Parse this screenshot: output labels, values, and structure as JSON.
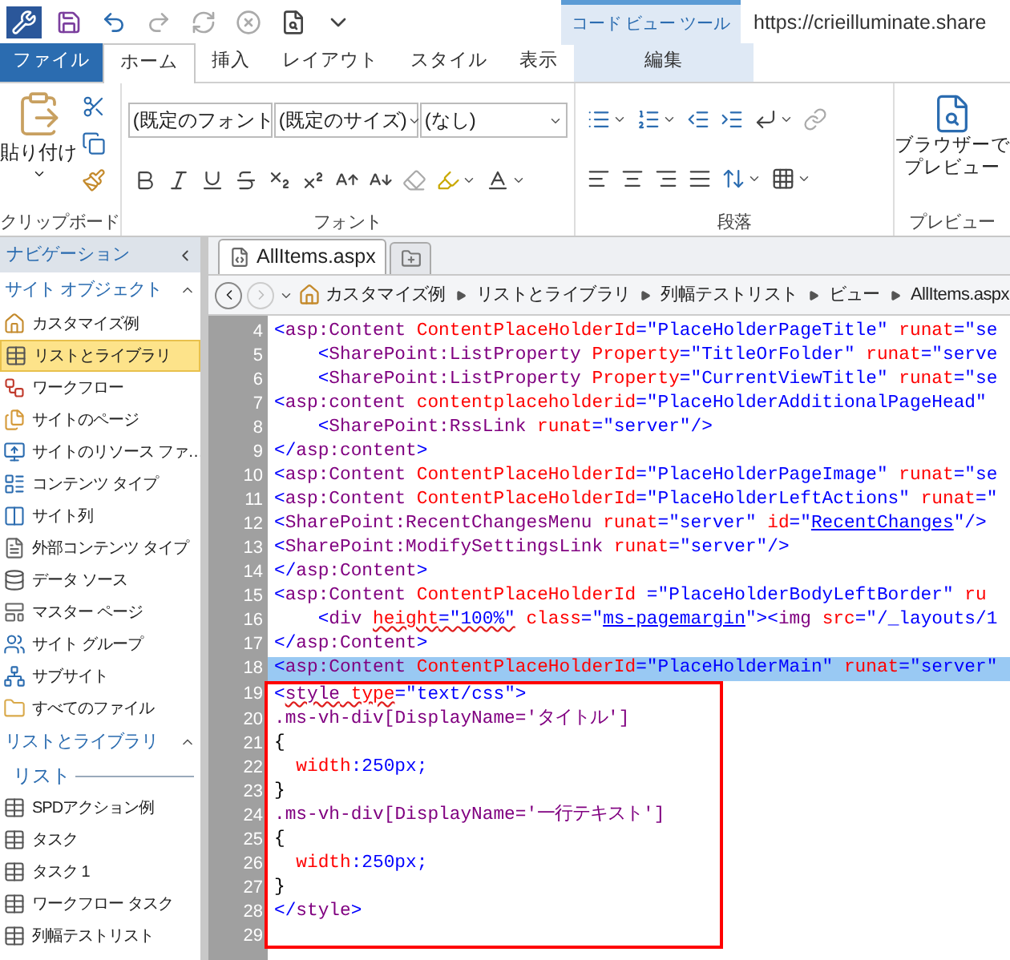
{
  "quick_access": [
    {
      "kind": "app",
      "disabled": false
    },
    {
      "kind": "save",
      "disabled": false
    },
    {
      "kind": "undo",
      "disabled": false
    },
    {
      "kind": "redo",
      "disabled": true
    },
    {
      "kind": "refresh",
      "disabled": true
    },
    {
      "kind": "stop",
      "disabled": true
    },
    {
      "kind": "preview",
      "disabled": false
    },
    {
      "kind": "customize",
      "disabled": false
    }
  ],
  "context_group": "コード ビュー ツール",
  "url": "https://crieilluminate.share",
  "ribbon_tabs": [
    {
      "label": "ファイル",
      "kind": "file",
      "selected": false
    },
    {
      "label": "ホーム",
      "kind": "normal",
      "selected": true
    },
    {
      "label": "挿入",
      "kind": "normal",
      "selected": false
    },
    {
      "label": "レイアウト",
      "kind": "normal",
      "selected": false
    },
    {
      "label": "スタイル",
      "kind": "normal",
      "selected": false
    },
    {
      "label": "表示",
      "kind": "normal",
      "selected": false
    },
    {
      "label": "編集",
      "kind": "context",
      "selected": false
    }
  ],
  "ribbon": {
    "clipboard": {
      "label": "クリップボード",
      "paste": "貼り付け"
    },
    "font": {
      "label": "フォント",
      "font_name": "(既定のフォント",
      "font_size": "(既定のサイズ)",
      "style": "(なし)"
    },
    "paragraph": {
      "label": "段落"
    },
    "preview": {
      "label": "プレビュー",
      "button": [
        "ブラウザーで",
        "プレビュー"
      ]
    }
  },
  "navigation": {
    "title": "ナビゲーション",
    "sections": [
      {
        "title": "サイト オブジェクト",
        "expanded": true,
        "items": [
          {
            "label": "カスタマイズ例",
            "kind": "home",
            "selected": false
          },
          {
            "label": "リストとライブラリ",
            "kind": "list",
            "selected": true
          },
          {
            "label": "ワークフロー",
            "kind": "workflow",
            "selected": false
          },
          {
            "label": "サイトのページ",
            "kind": "pages",
            "selected": false
          },
          {
            "label": "サイトのリソース ファ…",
            "kind": "assets",
            "selected": false
          },
          {
            "label": "コンテンツ タイプ",
            "kind": "content_type",
            "selected": false
          },
          {
            "label": "サイト列",
            "kind": "column",
            "selected": false
          },
          {
            "label": "外部コンテンツ タイプ",
            "kind": "external",
            "selected": false
          },
          {
            "label": "データ ソース",
            "kind": "data",
            "selected": false
          },
          {
            "label": "マスター ページ",
            "kind": "master",
            "selected": false
          },
          {
            "label": "サイト グループ",
            "kind": "groups",
            "selected": false
          },
          {
            "label": "サブサイト",
            "kind": "subsite",
            "selected": false
          },
          {
            "label": "すべてのファイル",
            "kind": "folder",
            "selected": false
          }
        ]
      },
      {
        "title": "リストとライブラリ",
        "expanded": true,
        "subheader": "リスト",
        "items": [
          {
            "label": "SPDアクション例",
            "kind": "list",
            "selected": false
          },
          {
            "label": "タスク",
            "kind": "list",
            "selected": false
          },
          {
            "label": "タスク 1",
            "kind": "list",
            "selected": false
          },
          {
            "label": "ワークフロー タスク",
            "kind": "list",
            "selected": false
          },
          {
            "label": "列幅テストリスト",
            "kind": "list",
            "selected": false
          }
        ]
      }
    ]
  },
  "document_tab": "AllItems.aspx",
  "breadcrumb": [
    "カスタマイズ例",
    "リストとライブラリ",
    "列幅テストリスト",
    "ビュー",
    "AllItems.aspx"
  ],
  "code": {
    "lines": [
      {
        "number": "4",
        "kind": "top",
        "selected": false,
        "boxed": false,
        "segments": [
          {
            "kind": "value",
            "text": "<"
          },
          {
            "kind": "tag",
            "text": "asp:Content "
          },
          {
            "kind": "attr",
            "text": "ContentPlaceHolderId"
          },
          {
            "kind": "value",
            "text": "=\"PlaceHolderPageTitle\" "
          },
          {
            "kind": "attr",
            "text": "runat"
          },
          {
            "kind": "value",
            "text": "=\"se"
          }
        ]
      },
      {
        "number": "5",
        "kind": "nested",
        "selected": false,
        "boxed": false,
        "segments": [
          {
            "kind": "value",
            "text": "<"
          },
          {
            "kind": "tag",
            "text": "SharePoint:ListProperty "
          },
          {
            "kind": "attr",
            "text": "Property"
          },
          {
            "kind": "value",
            "text": "=\"TitleOrFolder\" "
          },
          {
            "kind": "attr",
            "text": "runat"
          },
          {
            "kind": "value",
            "text": "=\"serve"
          }
        ]
      },
      {
        "number": "6",
        "kind": "nested",
        "selected": false,
        "boxed": false,
        "segments": [
          {
            "kind": "value",
            "text": "<"
          },
          {
            "kind": "tag",
            "text": "SharePoint:ListProperty "
          },
          {
            "kind": "attr",
            "text": "Property"
          },
          {
            "kind": "value",
            "text": "=\"CurrentViewTitle\" "
          },
          {
            "kind": "attr",
            "text": "runat"
          },
          {
            "kind": "value",
            "text": "=\"se"
          }
        ]
      },
      {
        "number": "7",
        "kind": "top",
        "selected": false,
        "boxed": false,
        "segments": [
          {
            "kind": "value",
            "text": "<"
          },
          {
            "kind": "tag",
            "text": "asp:content "
          },
          {
            "kind": "attr",
            "text": "contentplaceholderid"
          },
          {
            "kind": "value",
            "text": "=\"PlaceHolderAdditionalPageHead\""
          }
        ]
      },
      {
        "number": "8",
        "kind": "nested",
        "selected": false,
        "boxed": false,
        "segments": [
          {
            "kind": "value",
            "text": "<"
          },
          {
            "kind": "tag",
            "text": "SharePoint:RssLink "
          },
          {
            "kind": "attr",
            "text": "runat"
          },
          {
            "kind": "value",
            "text": "=\"server\"/>"
          }
        ]
      },
      {
        "number": "9",
        "kind": "top",
        "selected": false,
        "boxed": false,
        "segments": [
          {
            "kind": "value",
            "text": "</"
          },
          {
            "kind": "tag",
            "text": "asp:content"
          },
          {
            "kind": "value",
            "text": ">"
          }
        ]
      },
      {
        "number": "10",
        "kind": "top",
        "selected": false,
        "boxed": false,
        "segments": [
          {
            "kind": "value",
            "text": "<"
          },
          {
            "kind": "tag",
            "text": "asp:Content "
          },
          {
            "kind": "attr",
            "text": "ContentPlaceHolderId"
          },
          {
            "kind": "value",
            "text": "=\"PlaceHolderPageImage\" "
          },
          {
            "kind": "attr",
            "text": "runat"
          },
          {
            "kind": "value",
            "text": "=\"se"
          }
        ]
      },
      {
        "number": "11",
        "kind": "top",
        "selected": false,
        "boxed": false,
        "segments": [
          {
            "kind": "value",
            "text": "<"
          },
          {
            "kind": "tag",
            "text": "asp:Content "
          },
          {
            "kind": "attr",
            "text": "ContentPlaceHolderId"
          },
          {
            "kind": "value",
            "text": "=\"PlaceHolderLeftActions\" "
          },
          {
            "kind": "attr",
            "text": "runat"
          },
          {
            "kind": "value",
            "text": "=\""
          }
        ]
      },
      {
        "number": "12",
        "kind": "top",
        "selected": false,
        "boxed": false,
        "segments": [
          {
            "kind": "value",
            "text": "<"
          },
          {
            "kind": "tag",
            "text": "SharePoint:RecentChangesMenu "
          },
          {
            "kind": "attr",
            "text": "runat"
          },
          {
            "kind": "value",
            "text": "=\"server\" "
          },
          {
            "kind": "attr",
            "text": "id"
          },
          {
            "kind": "value",
            "text": "=\""
          },
          {
            "kind": "link",
            "text": "RecentChanges"
          },
          {
            "kind": "value",
            "text": "\"/>"
          }
        ]
      },
      {
        "number": "13",
        "kind": "top",
        "selected": false,
        "boxed": false,
        "segments": [
          {
            "kind": "value",
            "text": "<"
          },
          {
            "kind": "tag",
            "text": "SharePoint:ModifySettingsLink "
          },
          {
            "kind": "attr",
            "text": "runat"
          },
          {
            "kind": "value",
            "text": "=\"server\"/>"
          }
        ]
      },
      {
        "number": "14",
        "kind": "top",
        "selected": false,
        "boxed": false,
        "segments": [
          {
            "kind": "value",
            "text": "</"
          },
          {
            "kind": "tag",
            "text": "asp:Content"
          },
          {
            "kind": "value",
            "text": ">"
          }
        ]
      },
      {
        "number": "15",
        "kind": "top",
        "selected": false,
        "boxed": false,
        "segments": [
          {
            "kind": "value",
            "text": "<"
          },
          {
            "kind": "tag",
            "text": "asp:Content "
          },
          {
            "kind": "attr",
            "text": "ContentPlaceHolderId "
          },
          {
            "kind": "value",
            "text": "=\"PlaceHolderBodyLeftBorder\" "
          },
          {
            "kind": "attr",
            "text": "ru"
          }
        ]
      },
      {
        "number": "16",
        "kind": "nested",
        "selected": false,
        "boxed": false,
        "segments": [
          {
            "kind": "value",
            "text": "<"
          },
          {
            "kind": "tag",
            "text": "div "
          },
          {
            "kind": "misspelled_attr",
            "text": "height"
          },
          {
            "kind": "misspelled_value",
            "text": "=\"100%\""
          },
          {
            "kind": "attr",
            "text": " class"
          },
          {
            "kind": "value",
            "text": "=\""
          },
          {
            "kind": "link",
            "text": "ms-pagemargin"
          },
          {
            "kind": "value",
            "text": "\"><"
          },
          {
            "kind": "tag",
            "text": "img "
          },
          {
            "kind": "attr",
            "text": "src"
          },
          {
            "kind": "value",
            "text": "=\"/_layouts/1"
          }
        ]
      },
      {
        "number": "17",
        "kind": "top",
        "selected": false,
        "boxed": false,
        "segments": [
          {
            "kind": "value",
            "text": "</"
          },
          {
            "kind": "tag",
            "text": "asp:Content"
          },
          {
            "kind": "value",
            "text": ">"
          }
        ]
      },
      {
        "number": "18",
        "kind": "top",
        "selected": true,
        "boxed": false,
        "segments": [
          {
            "kind": "value",
            "text": "<"
          },
          {
            "kind": "tag",
            "text": "asp:Content "
          },
          {
            "kind": "attr",
            "text": "ContentPlaceHolderId"
          },
          {
            "kind": "value",
            "text": "=\"PlaceHolderMain\" "
          },
          {
            "kind": "attr",
            "text": "runat"
          },
          {
            "kind": "value",
            "text": "=\"server\""
          }
        ]
      },
      {
        "number": "19",
        "kind": "top",
        "selected": false,
        "boxed": true,
        "segments": [
          {
            "kind": "value",
            "text": "<"
          },
          {
            "kind": "misspelled_tag",
            "text": "style"
          },
          {
            "kind": "misspelled_attr",
            "text": " type"
          },
          {
            "kind": "value",
            "text": "=\"text/css\">"
          }
        ]
      },
      {
        "number": "20",
        "kind": "top",
        "selected": false,
        "boxed": true,
        "segments": [
          {
            "kind": "tag",
            "text": ".ms-vh-div[DisplayName='タイトル']"
          }
        ]
      },
      {
        "number": "21",
        "kind": "top",
        "selected": false,
        "boxed": true,
        "segments": [
          {
            "kind": "text",
            "text": "{"
          }
        ]
      },
      {
        "number": "22",
        "kind": "declaration",
        "selected": false,
        "boxed": true,
        "segments": [
          {
            "kind": "attr",
            "text": "width"
          },
          {
            "kind": "value",
            "text": ":250px;"
          }
        ]
      },
      {
        "number": "23",
        "kind": "top",
        "selected": false,
        "boxed": true,
        "segments": [
          {
            "kind": "text",
            "text": "}"
          }
        ]
      },
      {
        "number": "24",
        "kind": "top",
        "selected": false,
        "boxed": true,
        "segments": [
          {
            "kind": "tag",
            "text": ".ms-vh-div[DisplayName='一行テキスト']"
          }
        ]
      },
      {
        "number": "25",
        "kind": "top",
        "selected": false,
        "boxed": true,
        "segments": [
          {
            "kind": "text",
            "text": "{"
          }
        ]
      },
      {
        "number": "26",
        "kind": "declaration",
        "selected": false,
        "boxed": true,
        "segments": [
          {
            "kind": "attr",
            "text": "width"
          },
          {
            "kind": "value",
            "text": ":250px;"
          }
        ]
      },
      {
        "number": "27",
        "kind": "top",
        "selected": false,
        "boxed": true,
        "segments": [
          {
            "kind": "text",
            "text": "}"
          }
        ]
      },
      {
        "number": "28",
        "kind": "top",
        "selected": false,
        "boxed": true,
        "segments": [
          {
            "kind": "value",
            "text": "</"
          },
          {
            "kind": "tag",
            "text": "style"
          },
          {
            "kind": "value",
            "text": ">"
          }
        ]
      },
      {
        "number": "29",
        "kind": "top",
        "selected": false,
        "boxed": true
      }
    ]
  }
}
